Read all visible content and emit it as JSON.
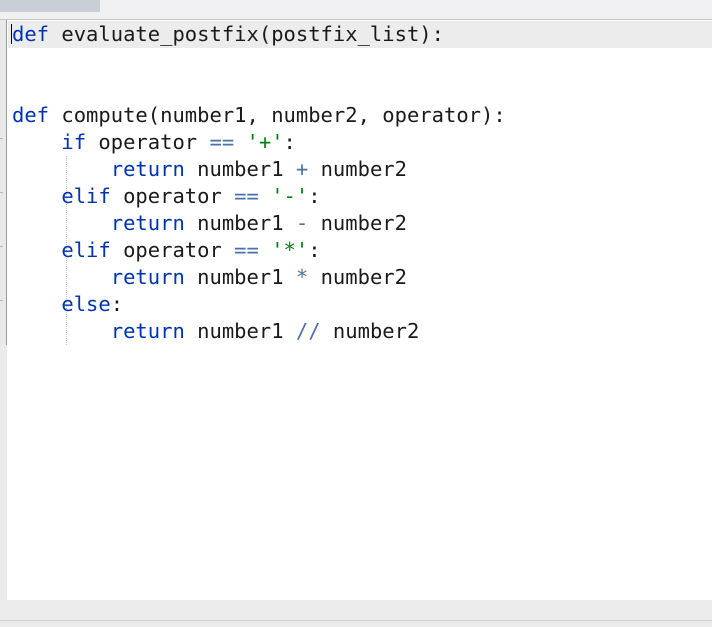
{
  "editor": {
    "lines": [
      [
        {
          "t": "def",
          "c": "kw"
        },
        {
          "t": " evaluate_postfix(postfix_list):",
          "c": ""
        }
      ],
      [],
      [],
      [
        {
          "t": "def",
          "c": "kw"
        },
        {
          "t": " compute(number1, number2, operator):",
          "c": ""
        }
      ],
      [
        {
          "t": "    ",
          "c": ""
        },
        {
          "t": "if",
          "c": "kw"
        },
        {
          "t": " operator ",
          "c": ""
        },
        {
          "t": "==",
          "c": "op"
        },
        {
          "t": " ",
          "c": ""
        },
        {
          "t": "'+'",
          "c": "str"
        },
        {
          "t": ":",
          "c": ""
        }
      ],
      [
        {
          "t": "        ",
          "c": ""
        },
        {
          "t": "return",
          "c": "kw"
        },
        {
          "t": " number1 ",
          "c": ""
        },
        {
          "t": "+",
          "c": "op"
        },
        {
          "t": " number2",
          "c": ""
        }
      ],
      [
        {
          "t": "    ",
          "c": ""
        },
        {
          "t": "elif",
          "c": "kw"
        },
        {
          "t": " operator ",
          "c": ""
        },
        {
          "t": "==",
          "c": "op"
        },
        {
          "t": " ",
          "c": ""
        },
        {
          "t": "'-'",
          "c": "str"
        },
        {
          "t": ":",
          "c": ""
        }
      ],
      [
        {
          "t": "        ",
          "c": ""
        },
        {
          "t": "return",
          "c": "kw"
        },
        {
          "t": " number1 ",
          "c": ""
        },
        {
          "t": "-",
          "c": "op"
        },
        {
          "t": " number2",
          "c": ""
        }
      ],
      [
        {
          "t": "    ",
          "c": ""
        },
        {
          "t": "elif",
          "c": "kw"
        },
        {
          "t": " operator ",
          "c": ""
        },
        {
          "t": "==",
          "c": "op"
        },
        {
          "t": " ",
          "c": ""
        },
        {
          "t": "'*'",
          "c": "str"
        },
        {
          "t": ":",
          "c": ""
        }
      ],
      [
        {
          "t": "        ",
          "c": ""
        },
        {
          "t": "return",
          "c": "kw"
        },
        {
          "t": " number1 ",
          "c": ""
        },
        {
          "t": "*",
          "c": "op"
        },
        {
          "t": " number2",
          "c": ""
        }
      ],
      [
        {
          "t": "    ",
          "c": ""
        },
        {
          "t": "else",
          "c": "kw"
        },
        {
          "t": ":",
          "c": ""
        }
      ],
      [
        {
          "t": "        ",
          "c": ""
        },
        {
          "t": "return",
          "c": "kw"
        },
        {
          "t": " number1 ",
          "c": ""
        },
        {
          "t": "//",
          "c": "op"
        },
        {
          "t": " number2",
          "c": ""
        }
      ]
    ]
  },
  "colors": {
    "keyword": "#0033b3",
    "operator": "#4a72a8",
    "string": "#067d17",
    "current_line": "#ececec"
  }
}
